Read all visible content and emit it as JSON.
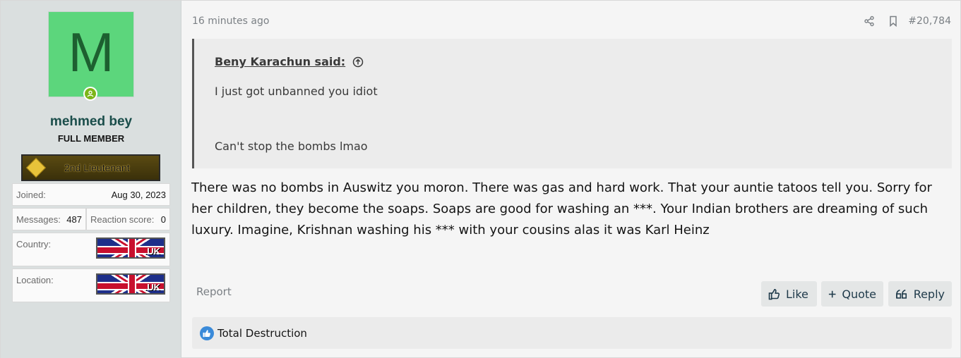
{
  "user": {
    "avatar_letter": "M",
    "avatar_color": "#5cd67c",
    "username": "mehmed bey",
    "user_title": "FULL MEMBER",
    "rank_label": "2nd Lieutenant",
    "joined_label": "Joined:",
    "joined_value": "Aug 30, 2023",
    "messages_label": "Messages:",
    "messages_value": "487",
    "reaction_label": "Reaction score:",
    "reaction_value": "0",
    "country_label": "Country:",
    "location_label": "Location:",
    "flag_text": ".UK"
  },
  "post": {
    "time": "16 minutes ago",
    "number": "#20,784",
    "quote": {
      "author": "Beny Karachun said:",
      "line1": "I just got unbanned you idiot",
      "line2": "Can't stop the bombs lmao"
    },
    "body": "There was no bombs in Auswitz you moron. There was gas and hard work. That your auntie tatoos tell you. Sorry for her children, they become the soaps. Soaps are good for washing an ***. Your Indian brothers are dreaming of such luxury. Imagine, Krishnan washing his *** with your cousins alas it was Karl Heinz",
    "report_label": "Report",
    "like_label": "Like",
    "quote_label": "Quote",
    "reply_label": "Reply",
    "reactions_text": "Total Destruction"
  },
  "icons": [
    "share-icon",
    "bookmark-icon",
    "arrow-up-circle-icon",
    "thumbs-up-icon",
    "plus-icon",
    "reply-quote-icon",
    "like-reaction-icon",
    "online-user-icon"
  ]
}
